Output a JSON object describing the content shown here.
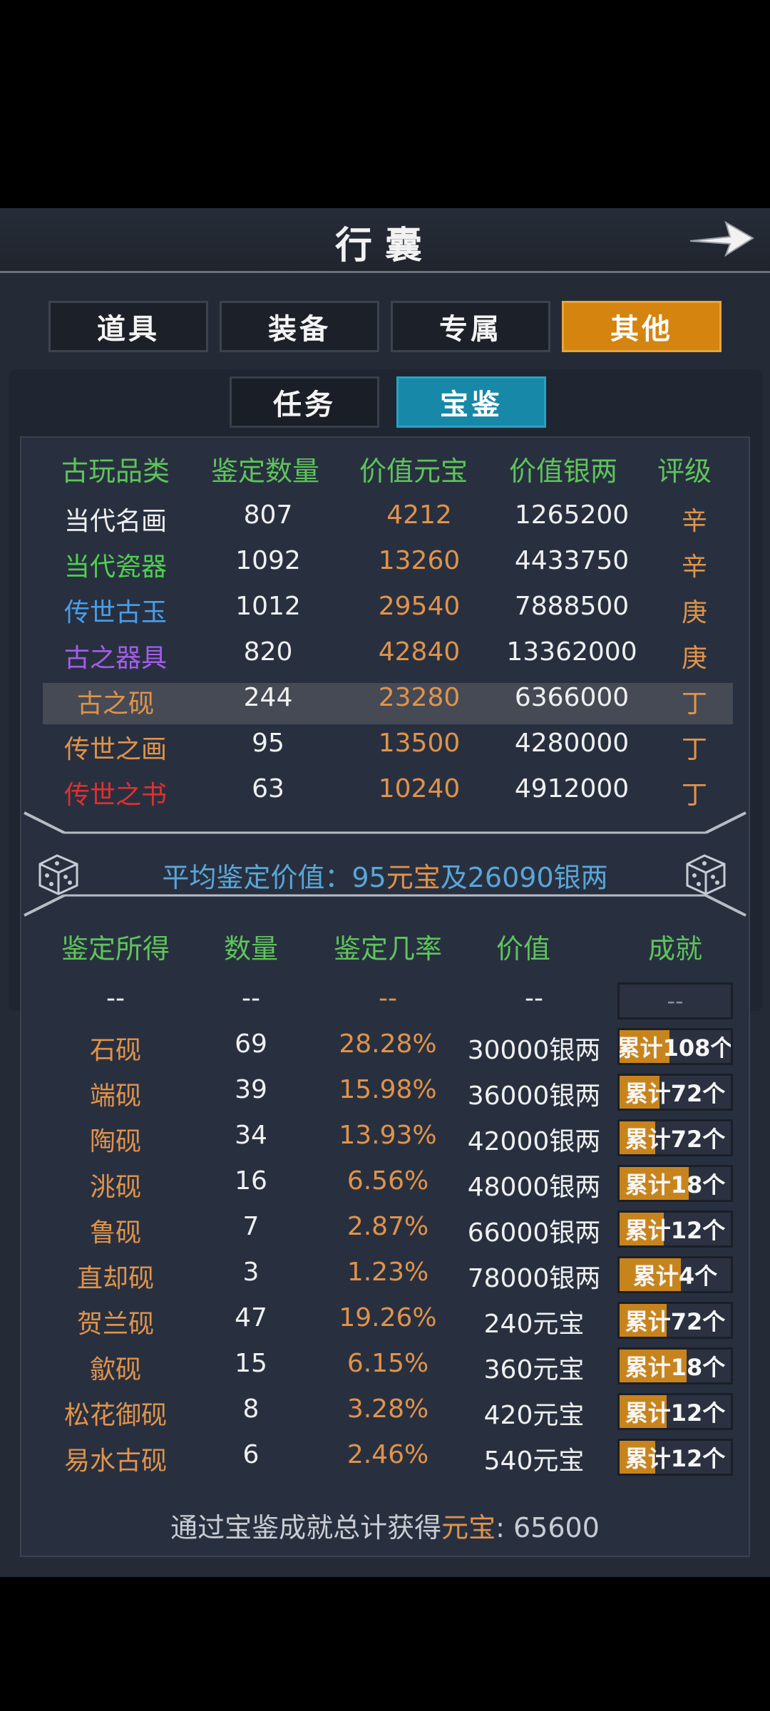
{
  "colors": {
    "header_green": "#5ec45a",
    "value_orange": "#e0934a",
    "tab_active": "#d4840f",
    "subtab_active": "#1888a8"
  },
  "window": {
    "title": "行囊",
    "back_icon": "right-arrow-icon"
  },
  "tabs": [
    {
      "label": "道具",
      "active": false
    },
    {
      "label": "装备",
      "active": false
    },
    {
      "label": "专属",
      "active": false
    },
    {
      "label": "其他",
      "active": true
    }
  ],
  "subtabs": [
    {
      "label": "任务",
      "active": false
    },
    {
      "label": "宝鉴",
      "active": true
    }
  ],
  "appraisal_table": {
    "headers": [
      "古玩品类",
      "鉴定数量",
      "价值元宝",
      "价值银两",
      "评级"
    ],
    "rows": [
      {
        "category": "当代名画",
        "count": "807",
        "yuanbao": "4212",
        "silver": "1265200",
        "grade": "辛",
        "color": "#f0f0f0"
      },
      {
        "category": "当代瓷器",
        "count": "1092",
        "yuanbao": "13260",
        "silver": "4433750",
        "grade": "辛",
        "color": "#4fcf4f"
      },
      {
        "category": "传世古玉",
        "count": "1012",
        "yuanbao": "29540",
        "silver": "7888500",
        "grade": "庚",
        "color": "#4a9ee8"
      },
      {
        "category": "古之器具",
        "count": "820",
        "yuanbao": "42840",
        "silver": "13362000",
        "grade": "庚",
        "color": "#a35ee8"
      },
      {
        "category": "古之砚",
        "count": "244",
        "yuanbao": "23280",
        "silver": "6366000",
        "grade": "丁",
        "color": "#e0934a"
      },
      {
        "category": "传世之画",
        "count": "95",
        "yuanbao": "13500",
        "silver": "4280000",
        "grade": "丁",
        "color": "#e0934a"
      },
      {
        "category": "传世之书",
        "count": "63",
        "yuanbao": "10240",
        "silver": "4912000",
        "grade": "丁",
        "color": "#e03030"
      }
    ]
  },
  "average": {
    "label": "平均鉴定价值：",
    "yuanbao_num": "95",
    "yuanbao_unit": "元宝",
    "and_text": "及",
    "silver_text": "26090银两"
  },
  "results_table": {
    "headers": [
      "鉴定所得",
      "数量",
      "鉴定几率",
      "价值",
      "成就"
    ],
    "placeholder": {
      "name": "--",
      "qty": "--",
      "rate": "--",
      "value": "--",
      "ach": "--"
    },
    "rows": [
      {
        "name": "石砚",
        "qty": "69",
        "rate": "28.28%",
        "value": "30000银两",
        "ach": "累计108个",
        "progress": 0.45
      },
      {
        "name": "端砚",
        "qty": "39",
        "rate": "15.98%",
        "value": "36000银两",
        "ach": "累计72个",
        "progress": 0.36
      },
      {
        "name": "陶砚",
        "qty": "34",
        "rate": "13.93%",
        "value": "42000银两",
        "ach": "累计72个",
        "progress": 0.32
      },
      {
        "name": "洮砚",
        "qty": "16",
        "rate": "6.56%",
        "value": "48000银两",
        "ach": "累计18个",
        "progress": 0.62
      },
      {
        "name": "鲁砚",
        "qty": "7",
        "rate": "2.87%",
        "value": "66000银两",
        "ach": "累计12个",
        "progress": 0.4
      },
      {
        "name": "直却砚",
        "qty": "3",
        "rate": "1.23%",
        "value": "78000银两",
        "ach": "累计4个",
        "progress": 0.55
      },
      {
        "name": "贺兰砚",
        "qty": "47",
        "rate": "19.26%",
        "value": "240元宝",
        "ach": "累计72个",
        "progress": 0.42
      },
      {
        "name": "歙砚",
        "qty": "15",
        "rate": "6.15%",
        "value": "360元宝",
        "ach": "累计18个",
        "progress": 0.6
      },
      {
        "name": "松花御砚",
        "qty": "8",
        "rate": "3.28%",
        "value": "420元宝",
        "ach": "累计12个",
        "progress": 0.42
      },
      {
        "name": "易水古砚",
        "qty": "6",
        "rate": "2.46%",
        "value": "540元宝",
        "ach": "累计12个",
        "progress": 0.32
      }
    ]
  },
  "footer": {
    "prefix": "通过宝鉴成就总计获得",
    "currency": "元宝",
    "suffix": ": 65600"
  }
}
